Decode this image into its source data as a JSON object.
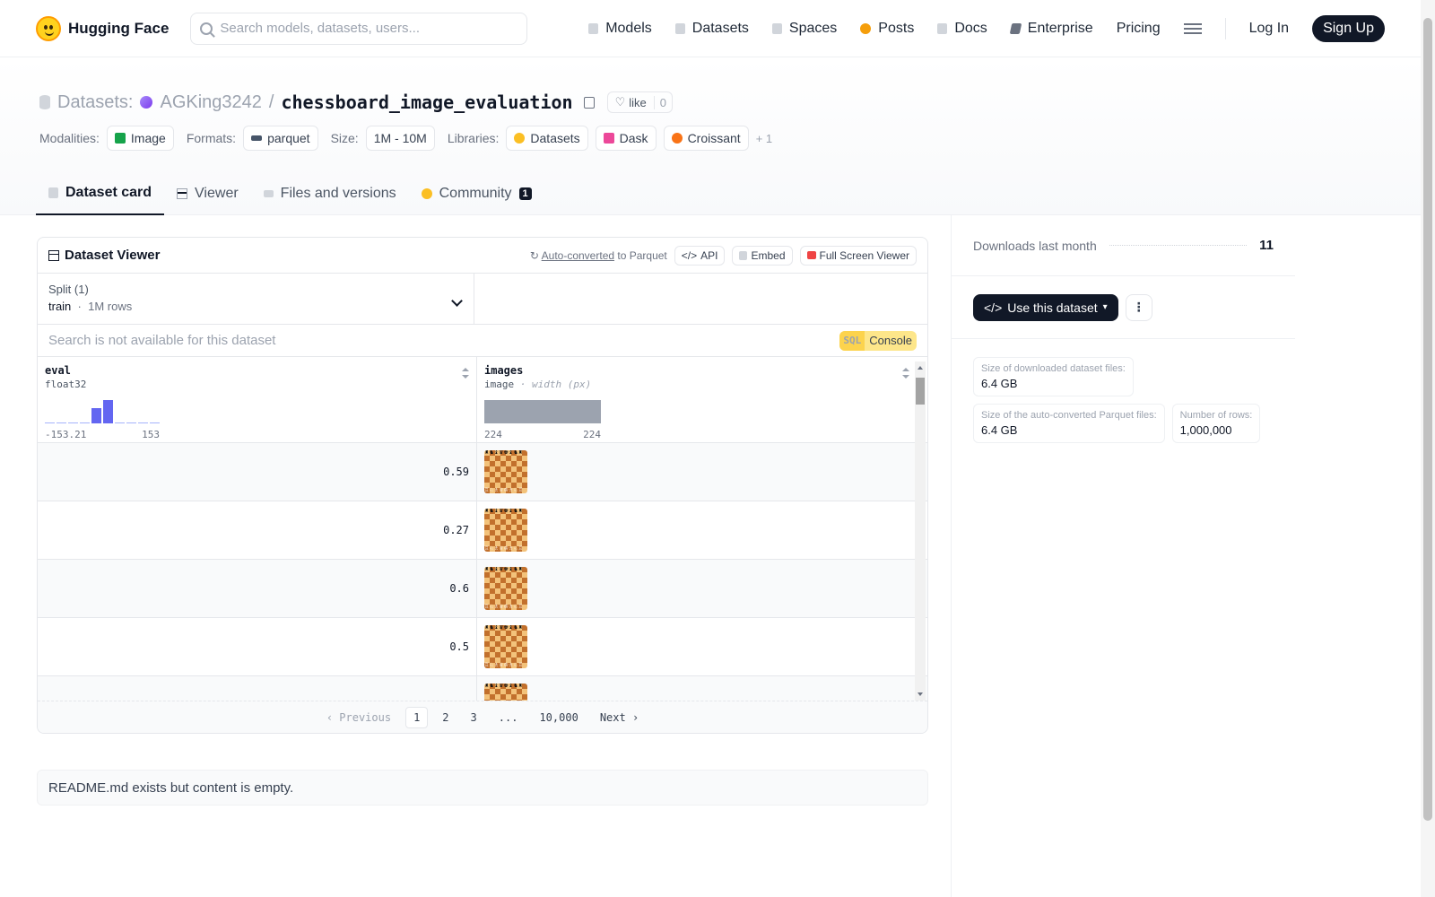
{
  "nav": {
    "brand": "Hugging Face",
    "search_placeholder": "Search models, datasets, users...",
    "links": [
      "Models",
      "Datasets",
      "Spaces",
      "Posts",
      "Docs",
      "Enterprise",
      "Pricing"
    ],
    "login": "Log In",
    "signup": "Sign Up"
  },
  "header": {
    "section": "Datasets:",
    "owner": "AGKing3242",
    "separator": "/",
    "name": "chessboard_image_evaluation",
    "like_label": "like",
    "like_count": "0",
    "modalities_label": "Modalities:",
    "modality": "Image",
    "formats_label": "Formats:",
    "format": "parquet",
    "size_label": "Size:",
    "size": "1M - 10M",
    "libraries_label": "Libraries:",
    "libraries": [
      "Datasets",
      "Dask",
      "Croissant"
    ],
    "more": "+ 1"
  },
  "tabs": {
    "card": "Dataset card",
    "viewer": "Viewer",
    "files": "Files and versions",
    "community": "Community",
    "community_count": "1"
  },
  "viewer": {
    "title": "Dataset Viewer",
    "auto_converted": "Auto-converted",
    "to_parquet": "to Parquet",
    "api": "API",
    "embed": "Embed",
    "fullscreen": "Full Screen Viewer",
    "split_label": "Split (1)",
    "split_name": "train",
    "split_rows": "1M rows",
    "search_disabled": "Search is not available for this dataset",
    "sql": "SQL",
    "console": "Console",
    "columns": [
      {
        "name": "eval",
        "type": "float32",
        "min": "-153.21",
        "max": "153"
      },
      {
        "name": "images",
        "type": "image",
        "subtype": "· width (px)",
        "min": "224",
        "max": "224"
      }
    ],
    "histogram": [
      0,
      0,
      0,
      0,
      0.65,
      1,
      0,
      0,
      0,
      0
    ],
    "rows": [
      "0.59",
      "0.27",
      "0.6",
      "0.5",
      ""
    ],
    "pager": {
      "prev": "Previous",
      "pages": [
        "1",
        "2",
        "3",
        "...",
        "10,000"
      ],
      "next": "Next"
    }
  },
  "readme": "README.md exists but content is empty.",
  "sidebar": {
    "downloads_label": "Downloads last month",
    "downloads": "11",
    "use_button": "Use this dataset",
    "stats": [
      {
        "k": "Size of downloaded dataset files:",
        "v": "6.4 GB"
      },
      {
        "k": "Size of the auto-converted Parquet files:",
        "v": "6.4 GB"
      },
      {
        "k": "Number of rows:",
        "v": "1,000,000"
      }
    ]
  }
}
